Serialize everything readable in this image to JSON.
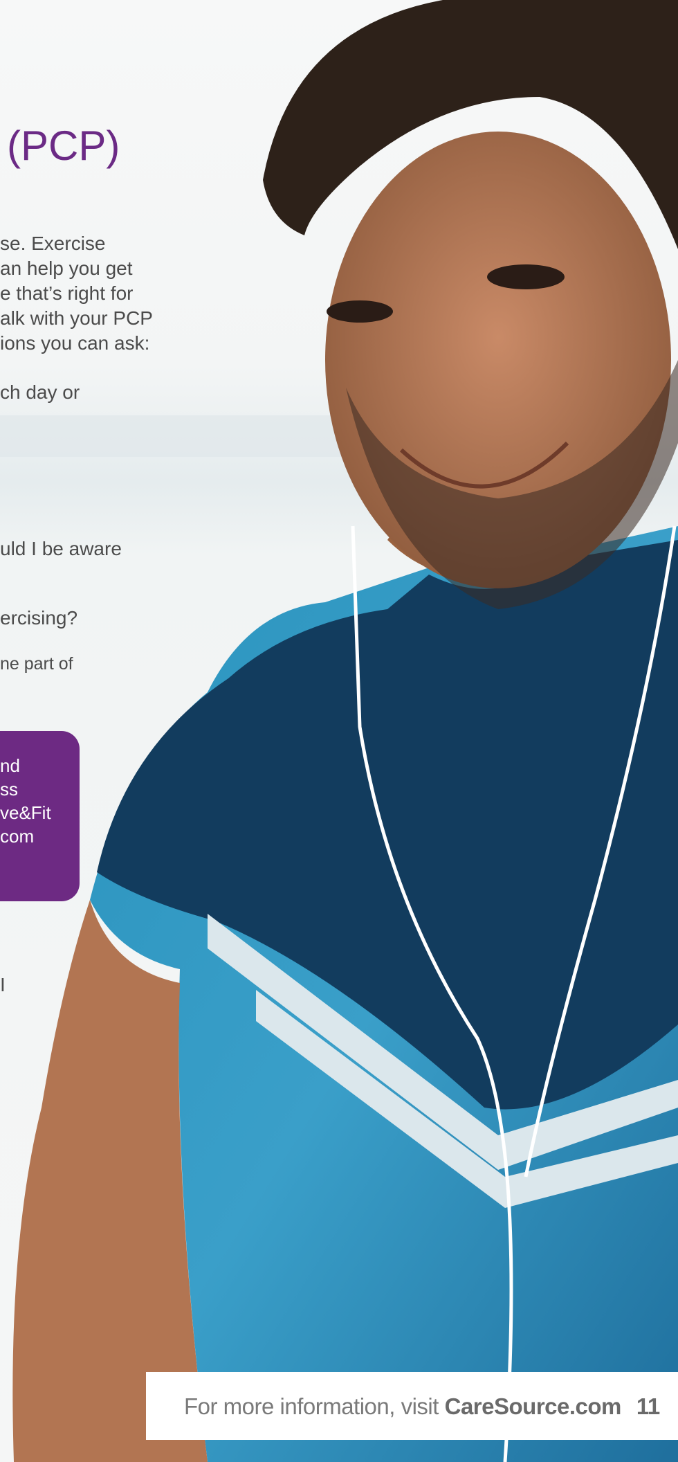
{
  "heading": "(PCP)",
  "intro_lines": [
    "se. Exercise",
    "an help you get",
    "e that’s right for",
    "alk with your PCP",
    "ions you can ask:"
  ],
  "question_fragments": {
    "q1": "ch day or",
    "q2": "uld I be aware",
    "q3": "ercising?",
    "q4": "ne part of"
  },
  "callout_lines": [
    "nd",
    "ss",
    "ve&Fit",
    "com"
  ],
  "stray_fragment": "I",
  "footer": {
    "prefix": "For more information, visit ",
    "brand": "CareSource.com",
    "page_number": "11"
  },
  "colors": {
    "heading_purple": "#6b2a85",
    "callout_purple": "#6d2a83",
    "body_text": "#4b4b4b",
    "footer_bg": "#ffffff"
  }
}
